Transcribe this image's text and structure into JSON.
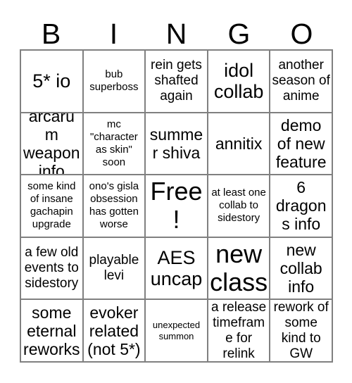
{
  "card": {
    "header_letters": [
      "B",
      "I",
      "N",
      "G",
      "O"
    ],
    "grid_line_color": "#808080",
    "text_color": "#000000",
    "background_color": "#ffffff",
    "rows": [
      [
        {
          "text": "5* io",
          "size": "xl"
        },
        {
          "text": "bub superboss",
          "size": "s"
        },
        {
          "text": "rein gets shafted again",
          "size": "m"
        },
        {
          "text": "idol collab",
          "size": "xl"
        },
        {
          "text": "another season of anime",
          "size": "m"
        }
      ],
      [
        {
          "text": "arcarum weapon info",
          "size": "l"
        },
        {
          "text": "mc \"character as skin\" soon",
          "size": "s"
        },
        {
          "text": "summer shiva",
          "size": "l"
        },
        {
          "text": "annitix",
          "size": "l"
        },
        {
          "text": "demo of new feature",
          "size": "l"
        }
      ],
      [
        {
          "text": "some kind of insane gachapin upgrade",
          "size": "s"
        },
        {
          "text": "ono's gisla obsession has gotten worse",
          "size": "s"
        },
        {
          "text": "Free!",
          "size": "xxl"
        },
        {
          "text": "at least one collab to sidestory",
          "size": "s"
        },
        {
          "text": "6 dragons info",
          "size": "l"
        }
      ],
      [
        {
          "text": "a few old events to sidestory",
          "size": "m"
        },
        {
          "text": "playable levi",
          "size": "m"
        },
        {
          "text": "AES uncap",
          "size": "xl"
        },
        {
          "text": "new class",
          "size": "xxl"
        },
        {
          "text": "new collab info",
          "size": "l"
        }
      ],
      [
        {
          "text": "some eternal reworks",
          "size": "l"
        },
        {
          "text": "evoker related (not 5*)",
          "size": "l"
        },
        {
          "text": "unexpected summon",
          "size": "xs"
        },
        {
          "text": "a release timeframe for relink",
          "size": "m"
        },
        {
          "text": "rework of some kind to GW",
          "size": "m"
        }
      ]
    ]
  }
}
